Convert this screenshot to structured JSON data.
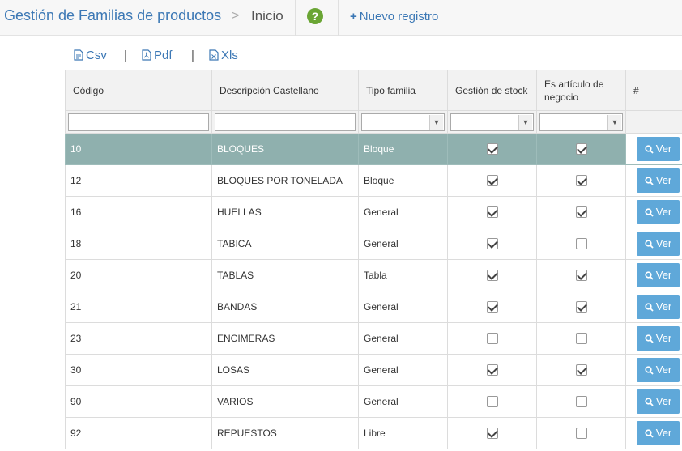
{
  "header": {
    "title": "Gestión de Familias de productos",
    "separator": ">",
    "breadcrumb": "Inicio",
    "help_icon": "?",
    "new_record": "Nuevo registro",
    "plus_icon": "+"
  },
  "exports": [
    {
      "label": "Csv",
      "icon": "file-csv-icon"
    },
    {
      "label": "Pdf",
      "icon": "file-pdf-icon"
    },
    {
      "label": "Xls",
      "icon": "file-excel-icon"
    }
  ],
  "exports_separator": "|",
  "table": {
    "columns": {
      "codigo": "Código",
      "descripcion": "Descripción Castellano",
      "tipo": "Tipo familia",
      "stock": "Gestión de stock",
      "negocio": "Es artículo de negocio",
      "actions": "#"
    },
    "action_label": "Ver",
    "rows": [
      {
        "codigo": "10",
        "descripcion": "BLOQUES",
        "tipo": "Bloque",
        "stock": true,
        "negocio": true,
        "selected": true
      },
      {
        "codigo": "12",
        "descripcion": "BLOQUES POR TONELADA",
        "tipo": "Bloque",
        "stock": true,
        "negocio": true
      },
      {
        "codigo": "16",
        "descripcion": "HUELLAS",
        "tipo": "General",
        "stock": true,
        "negocio": true
      },
      {
        "codigo": "18",
        "descripcion": "TABICA",
        "tipo": "General",
        "stock": true,
        "negocio": false
      },
      {
        "codigo": "20",
        "descripcion": "TABLAS",
        "tipo": "Tabla",
        "stock": true,
        "negocio": true
      },
      {
        "codigo": "21",
        "descripcion": "BANDAS",
        "tipo": "General",
        "stock": true,
        "negocio": true
      },
      {
        "codigo": "23",
        "descripcion": "ENCIMERAS",
        "tipo": "General",
        "stock": false,
        "negocio": false
      },
      {
        "codigo": "30",
        "descripcion": "LOSAS",
        "tipo": "General",
        "stock": true,
        "negocio": true
      },
      {
        "codigo": "90",
        "descripcion": "VARIOS",
        "tipo": "General",
        "stock": false,
        "negocio": false
      },
      {
        "codigo": "92",
        "descripcion": "REPUESTOS",
        "tipo": "Libre",
        "stock": true,
        "negocio": false
      }
    ]
  },
  "colors": {
    "link": "#3c78b5",
    "selected_row": "#8fb0ae",
    "button": "#5fa8d9",
    "help": "#6aa534"
  }
}
